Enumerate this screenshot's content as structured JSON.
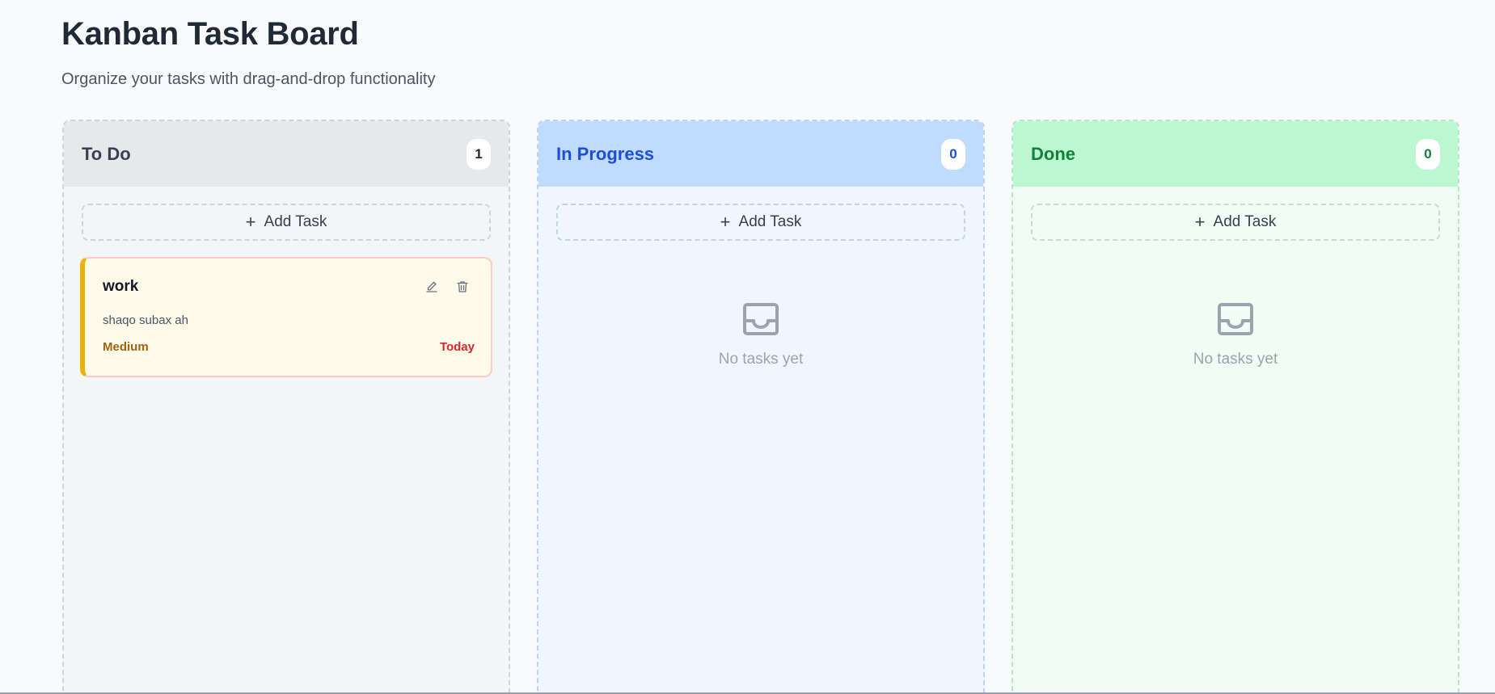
{
  "header": {
    "title": "Kanban Task Board",
    "subtitle": "Organize your tasks with drag-and-drop functionality"
  },
  "columns": [
    {
      "id": "todo",
      "title": "To Do",
      "count": "1",
      "add_label": "Add Task",
      "color": "#374151",
      "tasks": [
        {
          "title": "work",
          "description": "shaqo subax ah",
          "priority": "Medium",
          "due": "Today",
          "accent": "#eab308"
        }
      ]
    },
    {
      "id": "in-progress",
      "title": "In Progress",
      "count": "0",
      "add_label": "Add Task",
      "color": "#1d4ed8",
      "empty_text": "No tasks yet",
      "empty_icon": "inbox-icon"
    },
    {
      "id": "done",
      "title": "Done",
      "count": "0",
      "add_label": "Add Task",
      "color": "#15803d",
      "empty_text": "No tasks yet",
      "empty_icon": "inbox-icon"
    }
  ],
  "icons": {
    "add": "plus-icon",
    "edit": "pencil-icon",
    "delete": "trash-icon"
  }
}
